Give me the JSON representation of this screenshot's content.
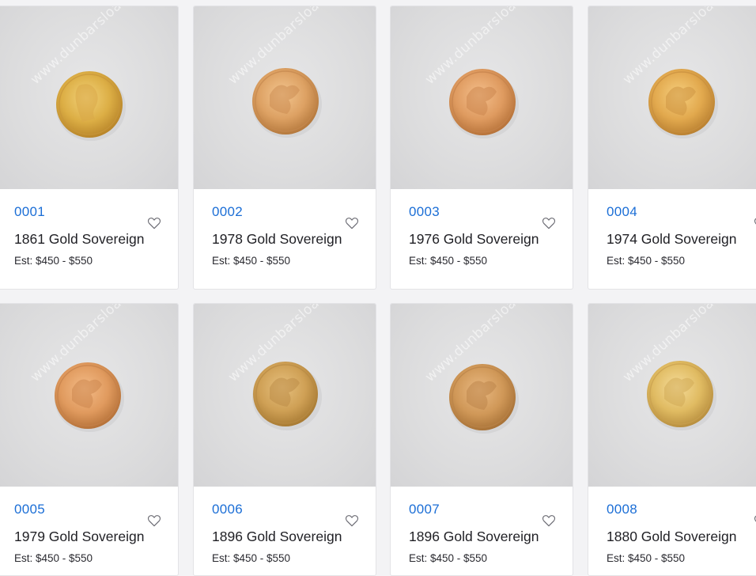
{
  "colors": {
    "lot_link": "#1b6ed6",
    "title_text": "#1f1f24",
    "card_bg": "#ffffff",
    "page_bg": "#f3f3f5"
  },
  "watermark_text": "www.dunbarsloane.co.nz",
  "icons": {
    "watchlist": "heart-outline-icon"
  },
  "lots": [
    {
      "lot": "0001",
      "title": "1861 Gold Sovereign",
      "estimate": "Est: $450 - $550"
    },
    {
      "lot": "0002",
      "title": "1978 Gold Sovereign",
      "estimate": "Est: $450 - $550"
    },
    {
      "lot": "0003",
      "title": "1976 Gold Sovereign",
      "estimate": "Est: $450 - $550"
    },
    {
      "lot": "0004",
      "title": "1974 Gold Sovereign",
      "estimate": "Est: $450 - $550"
    },
    {
      "lot": "0005",
      "title": "1979 Gold Sovereign",
      "estimate": "Est: $450 - $550"
    },
    {
      "lot": "0006",
      "title": "1896 Gold Sovereign",
      "estimate": "Est: $450 - $550"
    },
    {
      "lot": "0007",
      "title": "1896 Gold Sovereign",
      "estimate": "Est: $450 - $550"
    },
    {
      "lot": "0008",
      "title": "1880 Gold Sovereign",
      "estimate": "Est: $450 - $550"
    }
  ]
}
